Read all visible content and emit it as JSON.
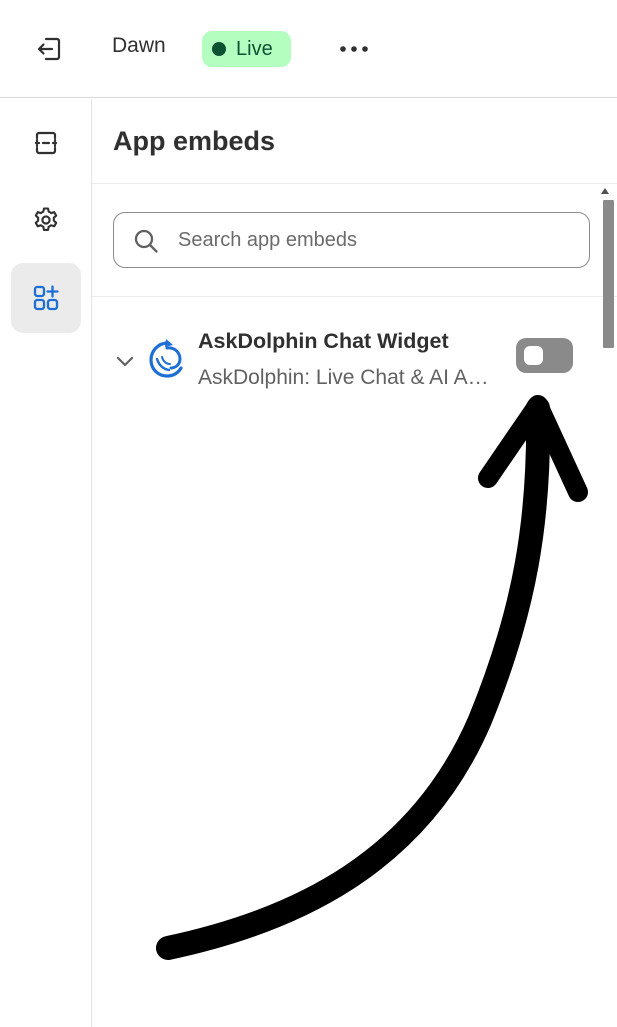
{
  "topbar": {
    "exit_icon": "exit-icon",
    "theme_name": "Dawn",
    "status_label": "Live",
    "status_color": "#b4fec0",
    "more_icon": "more-horizontal-icon"
  },
  "sidebar": {
    "items": [
      {
        "name": "sections",
        "icon": "sections-icon",
        "active": false
      },
      {
        "name": "theme-settings",
        "icon": "gear-icon",
        "active": false
      },
      {
        "name": "app-embeds",
        "icon": "apps-add-icon",
        "active": true
      }
    ]
  },
  "panel": {
    "title": "App embeds",
    "search": {
      "placeholder": "Search app embeds",
      "value": ""
    },
    "embeds": [
      {
        "title": "AskDolphin Chat Widget",
        "subtitle": "AskDolphin: Live Chat & AI Agent",
        "enabled": false,
        "logo_icon": "dolphin-logo-icon",
        "accent_color": "#1d6fd6"
      }
    ]
  },
  "annotation": {
    "type": "hand-drawn-arrow",
    "points_to": "toggle",
    "color": "#000000"
  }
}
